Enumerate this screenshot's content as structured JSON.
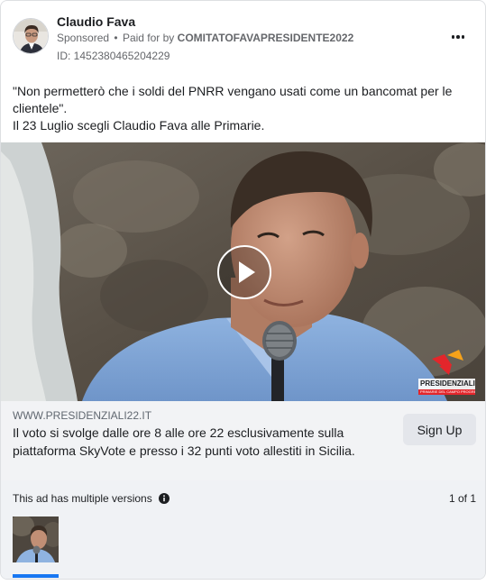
{
  "advertiser": {
    "name": "Claudio Fava",
    "sponsored": "Sponsored",
    "separator": "•",
    "paid_for_prefix": "Paid for by",
    "paid_for_by": "COMITATOFAVAPRESIDENTE2022",
    "id_label": "ID: 1452380465204229"
  },
  "menu": {
    "icon": "more-horizontal-icon"
  },
  "body": {
    "line1": "\"Non permetterò che i soldi del PNRR vengano usati come un bancomat per le clientele\".",
    "line2": "Il 23 Luglio scegli Claudio Fava alle Primarie."
  },
  "video": {
    "icon": "play-icon",
    "watermark_title": "PRESIDENZIALI",
    "watermark_subtitle": "PRIMARIE DEL CAMPO PROGRESSISTA"
  },
  "link": {
    "url": "WWW.PRESIDENZIALI22.IT",
    "description": "Il voto si svolge dalle ore 8 alle ore 22 esclusivamente sulla piattaforma SkyVote e presso i 32 punti voto allestiti in Sicilia.",
    "cta_label": "Sign Up"
  },
  "versions": {
    "label": "This ad has multiple versions",
    "info_icon": "info-icon",
    "count": "1 of 1"
  },
  "colors": {
    "accent": "#1877f2",
    "footer_bg": "#f2f3f5",
    "versions_bg": "#f0f2f5",
    "secondary_text": "#65676b",
    "watermark_red": "#e3262b"
  }
}
